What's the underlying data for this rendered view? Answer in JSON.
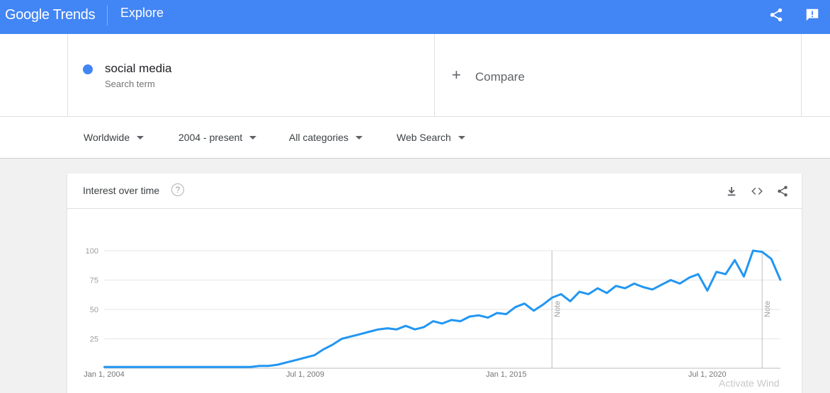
{
  "header": {
    "logo_text": "Google Trends",
    "section": "Explore",
    "share_icon": "share-icon",
    "feedback_icon": "feedback-icon",
    "color": "#4285f4"
  },
  "search": {
    "term": "social media",
    "term_type": "Search term",
    "term_color": "#4285f4",
    "compare_label": "Compare"
  },
  "filters": [
    {
      "label": "Worldwide"
    },
    {
      "label": "2004 - present"
    },
    {
      "label": "All categories"
    },
    {
      "label": "Web Search"
    }
  ],
  "card": {
    "title": "Interest over time",
    "help_icon": "help-circle-icon",
    "actions": [
      "download-icon",
      "embed-code-icon",
      "share-icon"
    ]
  },
  "chart_data": {
    "type": "line",
    "title": "Interest over time",
    "xlabel": "",
    "ylabel": "",
    "ylim": [
      0,
      100
    ],
    "yticks": [
      25,
      50,
      75,
      100
    ],
    "xticks": [
      "Jan 1, 2004",
      "Jul 1, 2009",
      "Jan 1, 2015",
      "Jul 1, 2020"
    ],
    "grid": true,
    "line_color": "#2196f3",
    "series": [
      {
        "name": "social media",
        "x": [
          "2004-01",
          "2004-04",
          "2004-07",
          "2004-10",
          "2005-01",
          "2005-04",
          "2005-07",
          "2005-10",
          "2006-01",
          "2006-04",
          "2006-07",
          "2006-10",
          "2007-01",
          "2007-04",
          "2007-07",
          "2007-10",
          "2008-01",
          "2008-04",
          "2008-07",
          "2008-10",
          "2009-01",
          "2009-04",
          "2009-07",
          "2009-10",
          "2010-01",
          "2010-04",
          "2010-07",
          "2010-10",
          "2011-01",
          "2011-04",
          "2011-07",
          "2011-10",
          "2012-01",
          "2012-04",
          "2012-07",
          "2012-10",
          "2013-01",
          "2013-04",
          "2013-07",
          "2013-10",
          "2014-01",
          "2014-04",
          "2014-07",
          "2014-10",
          "2015-01",
          "2015-04",
          "2015-07",
          "2015-10",
          "2016-01",
          "2016-04",
          "2016-07",
          "2016-10",
          "2017-01",
          "2017-04",
          "2017-07",
          "2017-10",
          "2018-01",
          "2018-04",
          "2018-07",
          "2018-10",
          "2019-01",
          "2019-04",
          "2019-07",
          "2019-10",
          "2020-01",
          "2020-04",
          "2020-07",
          "2020-10",
          "2021-01",
          "2021-04",
          "2021-07",
          "2021-10",
          "2022-01",
          "2022-04",
          "2022-07"
        ],
        "values": [
          1,
          1,
          1,
          1,
          1,
          1,
          1,
          1,
          1,
          1,
          1,
          1,
          1,
          1,
          1,
          1,
          1,
          2,
          2,
          3,
          5,
          7,
          9,
          11,
          16,
          20,
          25,
          27,
          29,
          31,
          33,
          34,
          33,
          36,
          33,
          35,
          40,
          38,
          41,
          40,
          44,
          45,
          43,
          47,
          46,
          52,
          55,
          49,
          54,
          60,
          63,
          57,
          65,
          63,
          68,
          64,
          70,
          68,
          72,
          69,
          67,
          71,
          75,
          72,
          77,
          80,
          66,
          82,
          80,
          92,
          78,
          100,
          99,
          93,
          75
        ]
      }
    ],
    "annotations": [
      "Note",
      "Note"
    ]
  },
  "watermark": "Activate Wind"
}
